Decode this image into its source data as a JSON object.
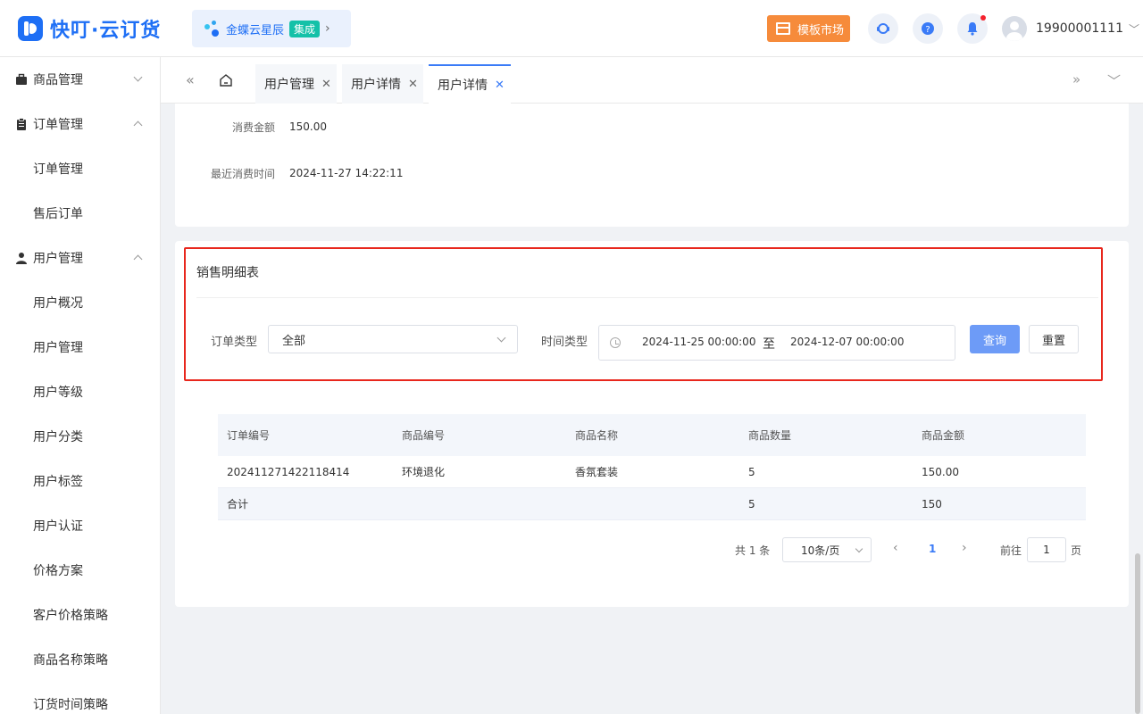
{
  "header": {
    "logo_text": "快叮·云订货",
    "kingdee_text": "金蝶云星辰",
    "kingdee_badge": "集成",
    "market_button": "模板市场",
    "user_phone": "19900001111",
    "icons": [
      "service-icon",
      "help-icon",
      "bell-icon"
    ]
  },
  "sidebar": {
    "groups": [
      {
        "label": "商品管理",
        "icon": "briefcase-icon",
        "expanded": false
      },
      {
        "label": "订单管理",
        "icon": "clipboard-icon",
        "expanded": true,
        "items": [
          "订单管理",
          "售后订单"
        ]
      },
      {
        "label": "用户管理",
        "icon": "user-icon",
        "expanded": true,
        "items": [
          "用户概况",
          "用户管理",
          "用户等级",
          "用户分类",
          "用户标签",
          "用户认证",
          "价格方案",
          "客户价格策略",
          "商品名称策略",
          "订货时间策略"
        ]
      }
    ]
  },
  "tabs": [
    {
      "label": "用户管理",
      "active": false
    },
    {
      "label": "用户详情",
      "active": false
    },
    {
      "label": "用户详情",
      "active": true
    }
  ],
  "info": [
    {
      "label": "消费金额",
      "value": "150.00"
    },
    {
      "label": "最近消费时间",
      "value": "2024-11-27 14:22:11"
    }
  ],
  "sales": {
    "title": "销售明细表",
    "order_type_label": "订单类型",
    "order_type_value": "全部",
    "time_type_label": "时间类型",
    "date_start": "2024-11-25 00:00:00",
    "date_sep": "至",
    "date_end": "2024-12-07 00:00:00",
    "query_button": "查询",
    "reset_button": "重置"
  },
  "table": {
    "columns": [
      "订单编号",
      "商品编号",
      "商品名称",
      "商品数量",
      "商品金额"
    ],
    "rows": [
      [
        "202411271422118414",
        "环境退化",
        "香氛套装",
        "5",
        "150.00"
      ]
    ],
    "total": [
      "合计",
      "",
      "",
      "5",
      "150"
    ]
  },
  "pagination": {
    "total": "共 1 条",
    "page_size": "10条/页",
    "current": "1",
    "goto_label": "前往",
    "goto_value": "1",
    "page_suffix": "页"
  },
  "colors": {
    "brand": "#1e6ff5",
    "market": "#f68b3b",
    "highlight": "#e8271d",
    "primary_button": "#6d9bf7"
  }
}
